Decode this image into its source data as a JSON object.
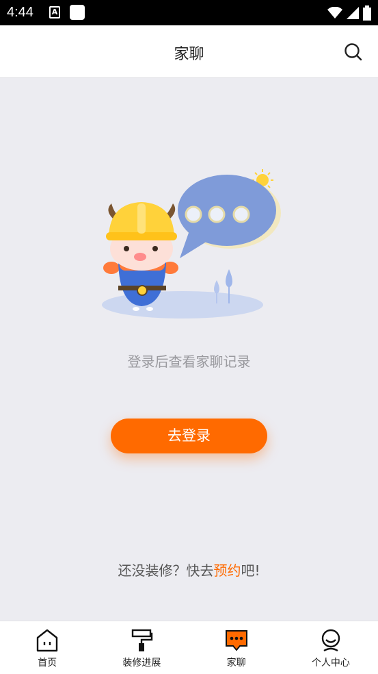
{
  "status_bar": {
    "time": "4:44",
    "icons": [
      "a-notification-icon",
      "square-notification-icon",
      "wifi-icon",
      "signal-icon",
      "battery-icon"
    ]
  },
  "header": {
    "title": "家聊",
    "search_icon": "search-icon"
  },
  "main": {
    "hint": "登录后查看家聊记录",
    "login_button": "去登录",
    "promo_prefix": "还没装修？快去",
    "promo_link": "预约",
    "promo_suffix": "吧!"
  },
  "tabbar": {
    "items": [
      {
        "label": "首页",
        "icon": "home-icon"
      },
      {
        "label": "装修进展",
        "icon": "paint-roller-icon"
      },
      {
        "label": "家聊",
        "icon": "chat-icon",
        "active": true
      },
      {
        "label": "个人中心",
        "icon": "user-icon"
      }
    ]
  },
  "colors": {
    "accent": "#ff6a00",
    "background": "#ececf1"
  }
}
